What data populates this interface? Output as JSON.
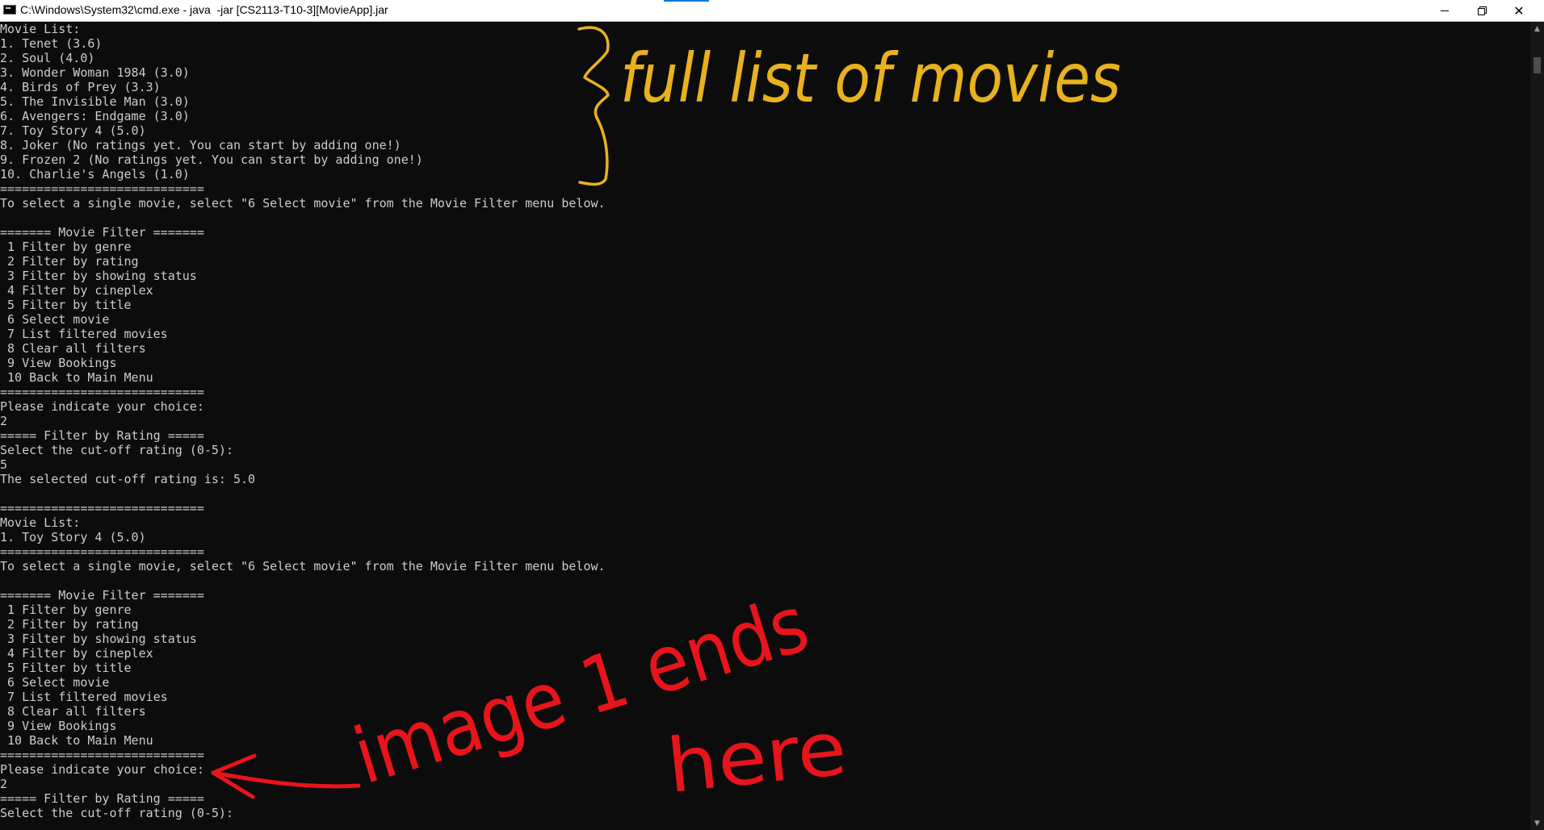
{
  "window": {
    "title": "C:\\Windows\\System32\\cmd.exe - java  -jar [CS2113-T10-3][MovieApp].jar",
    "minimize_icon": "minimize-icon",
    "maximize_icon": "restore-icon",
    "close_icon": "close-icon"
  },
  "console": {
    "lines": [
      "Movie List:",
      "1. Tenet (3.6)",
      "2. Soul (4.0)",
      "3. Wonder Woman 1984 (3.0)",
      "4. Birds of Prey (3.3)",
      "5. The Invisible Man (3.0)",
      "6. Avengers: Endgame (3.0)",
      "7. Toy Story 4 (5.0)",
      "8. Joker (No ratings yet. You can start by adding one!)",
      "9. Frozen 2 (No ratings yet. You can start by adding one!)",
      "10. Charlie's Angels (1.0)",
      "============================",
      "To select a single movie, select \"6 Select movie\" from the Movie Filter menu below.",
      "",
      "======= Movie Filter =======",
      " 1 Filter by genre",
      " 2 Filter by rating",
      " 3 Filter by showing status",
      " 4 Filter by cineplex",
      " 5 Filter by title",
      " 6 Select movie",
      " 7 List filtered movies",
      " 8 Clear all filters",
      " 9 View Bookings",
      " 10 Back to Main Menu",
      "============================",
      "Please indicate your choice:",
      "2",
      "===== Filter by Rating =====",
      "Select the cut-off rating (0-5):",
      "5",
      "The selected cut-off rating is: 5.0",
      "",
      "============================",
      "Movie List:",
      "1. Toy Story 4 (5.0)",
      "============================",
      "To select a single movie, select \"6 Select movie\" from the Movie Filter menu below.",
      "",
      "======= Movie Filter =======",
      " 1 Filter by genre",
      " 2 Filter by rating",
      " 3 Filter by showing status",
      " 4 Filter by cineplex",
      " 5 Filter by title",
      " 6 Select movie",
      " 7 List filtered movies",
      " 8 Clear all filters",
      " 9 View Bookings",
      " 10 Back to Main Menu",
      "============================",
      "Please indicate your choice:",
      "2",
      "===== Filter by Rating =====",
      "Select the cut-off rating (0-5):"
    ]
  },
  "annotations": {
    "top_note": "full list of movies",
    "bottom_note_line1": "image 1 ends",
    "bottom_note_line2": "here",
    "top_color": "#e8b21e",
    "bottom_color": "#e8141b"
  },
  "scrollbar": {
    "up_icon": "scroll-up-arrow-icon",
    "down_icon": "scroll-down-arrow-icon"
  }
}
